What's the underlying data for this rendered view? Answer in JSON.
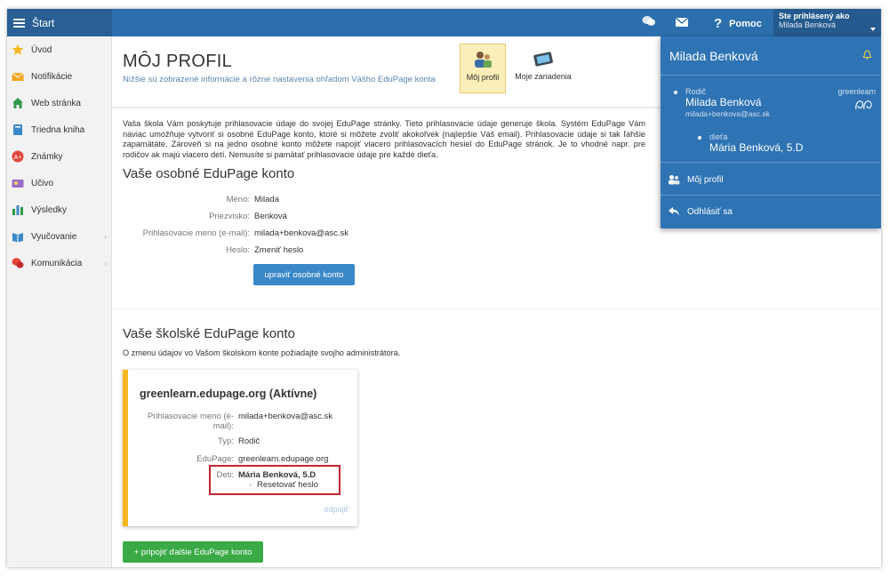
{
  "topbar": {
    "start_label": "Štart",
    "help_label": "Pomoc",
    "logged_in_label": "Ste prihlásený ako",
    "logged_in_user": "Milada Benková"
  },
  "sidebar": {
    "items": [
      {
        "label": "Úvod",
        "icon": "star-icon"
      },
      {
        "label": "Notifikácie",
        "icon": "envelope-icon"
      },
      {
        "label": "Web stránka",
        "icon": "home-icon"
      },
      {
        "label": "Triedna kniha",
        "icon": "book-icon"
      },
      {
        "label": "Známky",
        "icon": "grade-icon"
      },
      {
        "label": "Učivo",
        "icon": "lesson-icon"
      },
      {
        "label": "Výsledky",
        "icon": "chart-icon"
      },
      {
        "label": "Vyučovanie",
        "icon": "teaching-icon"
      },
      {
        "label": "Komunikácia",
        "icon": "chat-bubbles-icon"
      }
    ]
  },
  "header": {
    "title": "MÔJ PROFIL",
    "subtitle": "Nižšie sú zobrazené informácie a rôzne nastavenia ohľadom Vášho EduPage konta",
    "tab_profile": "Môj profil",
    "tab_devices": "Moje zariadenia"
  },
  "personal": {
    "intro": "Vaša škola Vám poskytuje prihlasovacie údaje do svojej EduPage stránky. Tieto prihlasovacie údaje generuje škola. Systém EduPage Vám naviac umožňuje vytvoriť si osobné EduPage konto, ktoré si môžete zvoliť akokoľvek (najlepšie Váš email). Prihlasovacie údaje si tak ľahšie zapamätáte. Zároveň si na jedno osobné konto môžete napojiť viacero prihlasovacích hesiel do EduPage stránok. Je to vhodné napr. pre rodičov ak majú viacero detí. Nemusíte si pamätať prihlasovacie údaje pre každé dieťa.",
    "heading": "Vaše osobné EduPage konto",
    "first_name_label": "Meno:",
    "first_name": "Milada",
    "last_name_label": "Priezvisko:",
    "last_name": "Benková",
    "login_label": "Prihlasovacie meno (e-mail):",
    "login": "milada+benkova@asc.sk",
    "password_label": "Heslo:",
    "password_link": "Zmeniť heslo",
    "edit_button": "upraviť osobné konto"
  },
  "school": {
    "heading": "Vaše školské EduPage konto",
    "note": "O zmenu údajov vo Vašom školskom konte požiadajte svojho administrátora.",
    "card_title": "greenlearn.edupage.org (Aktívne)",
    "login_label_1": "Prihlasovacie meno (e-",
    "login_label_2": "mail):",
    "login": "milada+benkova@asc.sk",
    "type_label": "Typ:",
    "type": "Rodič",
    "edupage_label": "EduPage:",
    "edupage": "greenlearn.edupage.org",
    "children_label": "Deti:",
    "child": "Mária Benková, 5.D",
    "reset_link": "Resetovať heslo",
    "disconnect": "odpojiť",
    "add_button": "+ pripojiť ďalšie EduPage konto"
  },
  "dropdown": {
    "name": "Milada Benková",
    "role": "Rodič",
    "parent_name": "Milada Benková",
    "email": "milada+benkova@asc.sk",
    "school": "greenleam",
    "child_role": "dieťa",
    "child_name": "Mária Benková, 5.D",
    "my_profile": "Môj profil",
    "logout": "Odhlásiť sa"
  },
  "colors": {
    "topbar": "#2c6fad",
    "dropdown": "#2e73b4",
    "accent_yellow": "#f3b71f",
    "button_blue": "#3a88c8",
    "button_green": "#3aaa46",
    "highlight_red": "#c0282e"
  }
}
